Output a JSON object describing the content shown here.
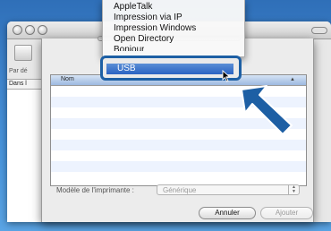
{
  "background_window": {
    "toolbar_label": "Par dé",
    "list_header_label": "Dans l"
  },
  "sheet": {
    "list": {
      "column_name": "Nom",
      "sort_icon": "▲"
    },
    "model": {
      "label": "Modèle de l'imprimante :",
      "value": "Générique"
    },
    "buttons": {
      "cancel": "Annuler",
      "add": "Ajouter"
    }
  },
  "menu": {
    "items": [
      "AppleTalk",
      "Impression via IP",
      "Impression Windows",
      "Open Directory",
      "Bonjour"
    ],
    "selected": "USB"
  },
  "colors": {
    "callout_arrow": "#1d5fa4",
    "selection": "#2a62c2"
  },
  "icons": {
    "cursor": "pointer-arrow-icon",
    "callout": "callout-arrow-icon"
  }
}
